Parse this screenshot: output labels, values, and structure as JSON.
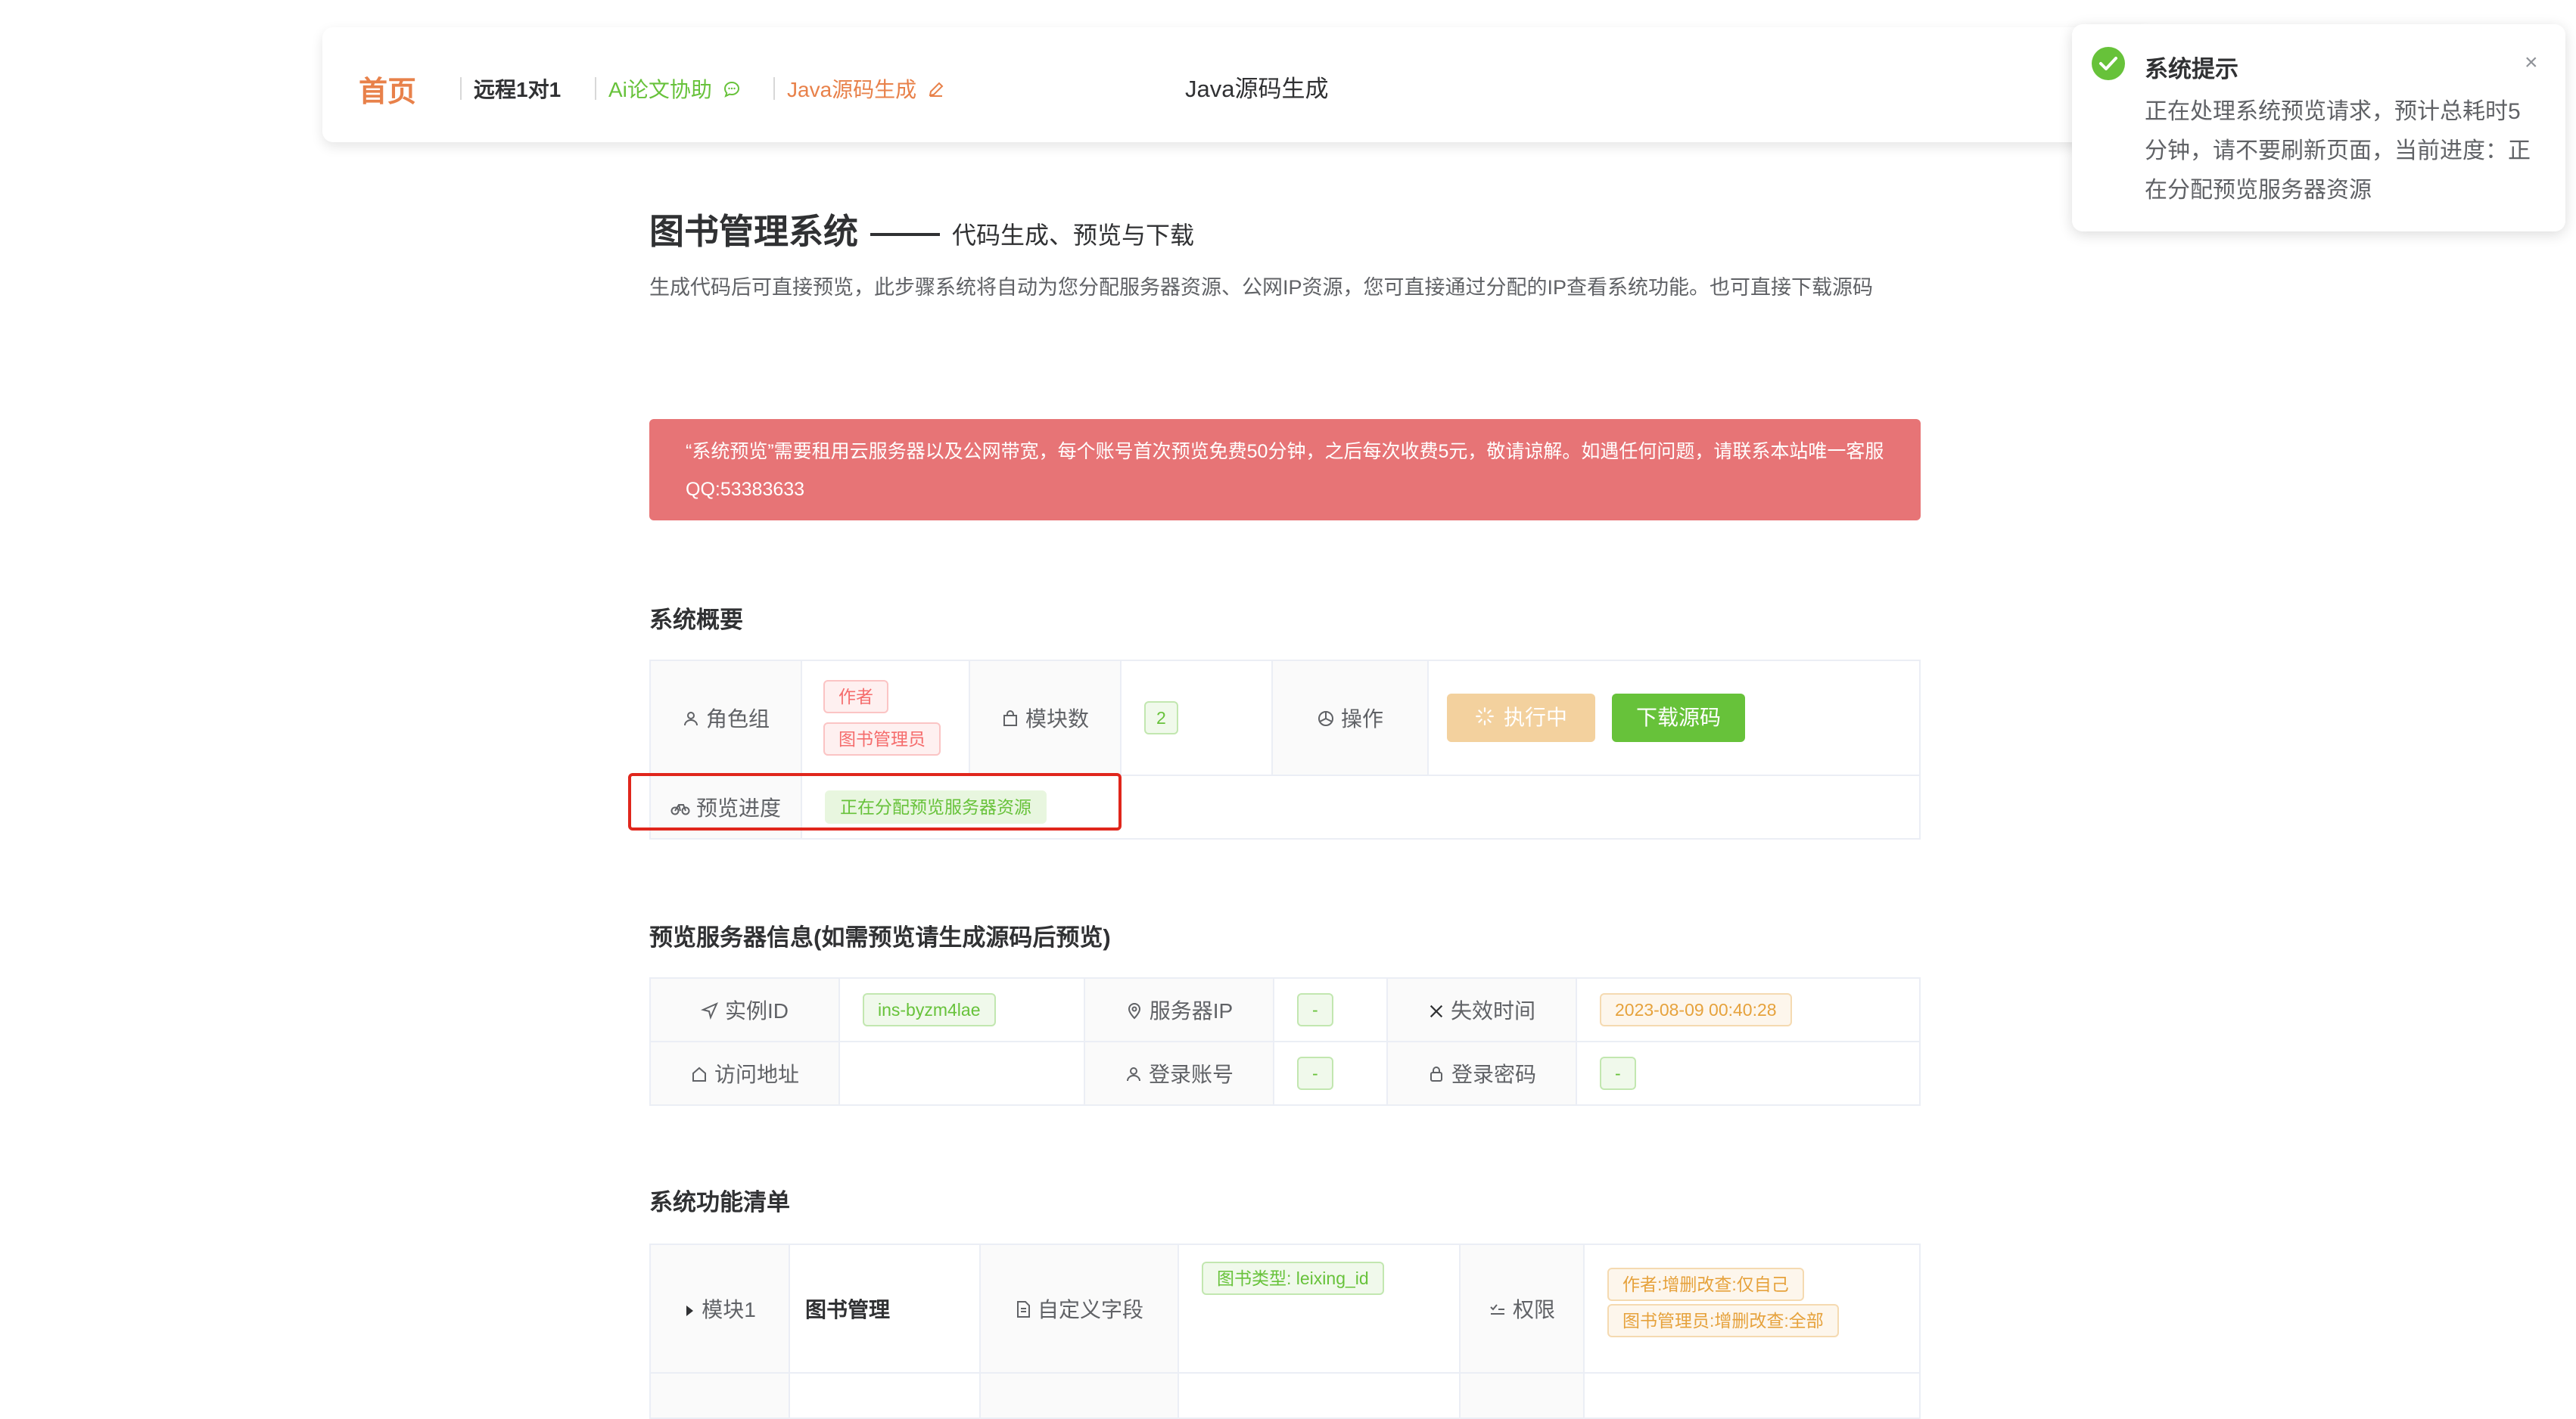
{
  "nav": {
    "home": "首页",
    "remote": "远程1对1",
    "ai": "Ai论文协助",
    "java": "Java源码生成",
    "center_title": "Java源码生成"
  },
  "page": {
    "title": "图书管理系统",
    "subtitle": "代码生成、预览与下载",
    "description": "生成代码后可直接预览，此步骤系统将自动为您分配服务器资源、公网IP资源，您可直接通过分配的IP查看系统功能。也可直接下载源码",
    "alert": "“系统预览”需要租用云服务器以及公网带宽，每个账号首次预览免费50分钟，之后每次收费5元，敬请谅解。如遇任何问题，请联系本站唯一客服QQ:53383633"
  },
  "overview": {
    "section_title": "系统概要",
    "role_label": "角色组",
    "roles": [
      "作者",
      "图书管理员"
    ],
    "module_count_label": "模块数",
    "module_count": "2",
    "action_label": "操作",
    "running_button": "执行中",
    "download_button": "下载源码",
    "progress_label": "预览进度",
    "progress_status": "正在分配预览服务器资源"
  },
  "server": {
    "section_title": "预览服务器信息(如需预览请生成源码后预览)",
    "instance_label": "实例ID",
    "instance_id": "ins-byzm4lae",
    "ip_label": "服务器IP",
    "ip": "-",
    "expire_label": "失效时间",
    "expire": "2023-08-09 00:40:28",
    "url_label": "访问地址",
    "url": "",
    "account_label": "登录账号",
    "account": "-",
    "password_label": "登录密码",
    "password": "-"
  },
  "features": {
    "section_title": "系统功能清单",
    "module_label": "模块1",
    "module_name": "图书管理",
    "custom_field_label": "自定义字段",
    "custom_field": "图书类型: leixing_id",
    "permission_label": "权限",
    "permissions": [
      "作者:增删改查:仅自己",
      "图书管理员:增删改查:全部"
    ]
  },
  "toast": {
    "title": "系统提示",
    "body": "正在处理系统预览请求，预计总耗时5分钟，请不要刷新页面，当前进度：正在分配预览服务器资源",
    "close": "×"
  },
  "colors": {
    "accent_orange": "#e8814a",
    "success_green": "#67c23a",
    "alert_red": "#e77476",
    "highlight_box": "#e0261c"
  }
}
